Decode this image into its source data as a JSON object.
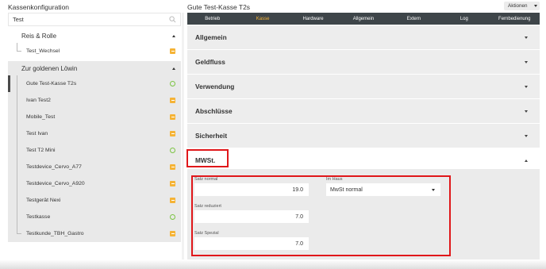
{
  "left": {
    "title": "Kassenkonfiguration",
    "search": {
      "value": "Test",
      "icon": "search-icon"
    },
    "groups": [
      {
        "label": "Reis & Rolle",
        "items": [
          {
            "label": "Test_Wechsel",
            "status": "warning"
          }
        ]
      },
      {
        "label": "Zur goldenen Löwin",
        "items": [
          {
            "label": "Gute Test-Kasse T2s",
            "status": "ok",
            "selected": true
          },
          {
            "label": "Ivan Test2",
            "status": "warning"
          },
          {
            "label": "Mobile_Test",
            "status": "warning"
          },
          {
            "label": "Test Ivan",
            "status": "warning"
          },
          {
            "label": "Test T2 Mini",
            "status": "ok"
          },
          {
            "label": "Testdevice_Cervo_A77",
            "status": "warning"
          },
          {
            "label": "Testdevice_Cervo_A920",
            "status": "warning"
          },
          {
            "label": "Testgerät Nexi",
            "status": "warning"
          },
          {
            "label": "Testkasse",
            "status": "ok"
          },
          {
            "label": "Testkunde_TBH_Gastro",
            "status": "warning"
          }
        ]
      }
    ]
  },
  "right": {
    "title": "Gute Test-Kasse T2s",
    "actions_label": "Aktionen",
    "tabs": [
      "Betrieb",
      "Kasse",
      "Hardware",
      "Allgemein",
      "Extern",
      "Log",
      "Fernbedienung"
    ],
    "active_tab": "Kasse",
    "sections": [
      "Allgemein",
      "Geldfluss",
      "Verwendung",
      "Abschlüsse",
      "Sicherheit"
    ],
    "open_section": "MWSt.",
    "mwst": {
      "satz_normal_label": "Satz normal",
      "satz_normal_value": "19.0",
      "im_haus_label": "Im Haus",
      "im_haus_value": "MwSt normal",
      "satz_reduziert_label": "Satz reduziert",
      "satz_reduziert_value": "7.0",
      "satz_spezial_label": "Satz Spezial",
      "satz_spezial_value": "7.0"
    }
  },
  "colors": {
    "tab_bar": "#3e4549",
    "active_tab": "#f5b335",
    "warning": "#f5b335",
    "ok": "#7cc443",
    "highlight": "#e0171a"
  }
}
